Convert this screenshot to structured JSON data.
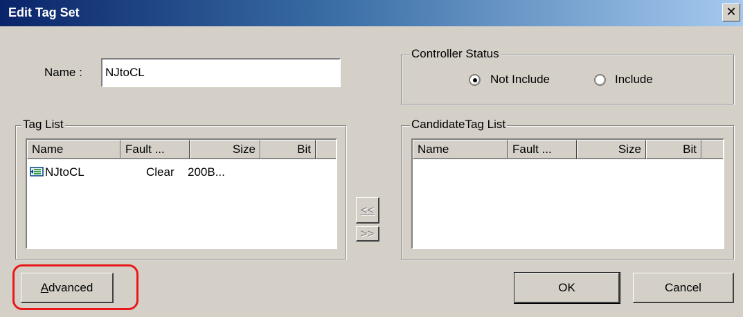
{
  "window": {
    "title": "Edit Tag Set",
    "close_label": "x"
  },
  "name_field": {
    "label": "Name :",
    "value": "NJtoCL"
  },
  "controller_status": {
    "title": "Controller Status",
    "options": [
      {
        "label": "Not Include",
        "selected": true
      },
      {
        "label": "Include",
        "selected": false
      }
    ]
  },
  "tag_list": {
    "title": "Tag List",
    "columns": [
      "Name",
      "Fault ...",
      "Size",
      "Bit"
    ],
    "rows": [
      {
        "icon": "tag-icon",
        "name": "NJtoCL",
        "fault": "Clear",
        "size": "200B...",
        "bit": ""
      }
    ]
  },
  "candidate_tag_list": {
    "title": "CandidateTag List",
    "columns": [
      "Name",
      "Fault ...",
      "Size",
      "Bit"
    ],
    "rows": []
  },
  "transfer": {
    "add_label": "<<",
    "remove_label": ">>"
  },
  "buttons": {
    "advanced": "Advanced",
    "ok": "OK",
    "cancel": "Cancel"
  },
  "colors": {
    "highlight": "#e8181a",
    "titlebar_start": "#0a246a",
    "titlebar_end": "#a6caf0"
  }
}
